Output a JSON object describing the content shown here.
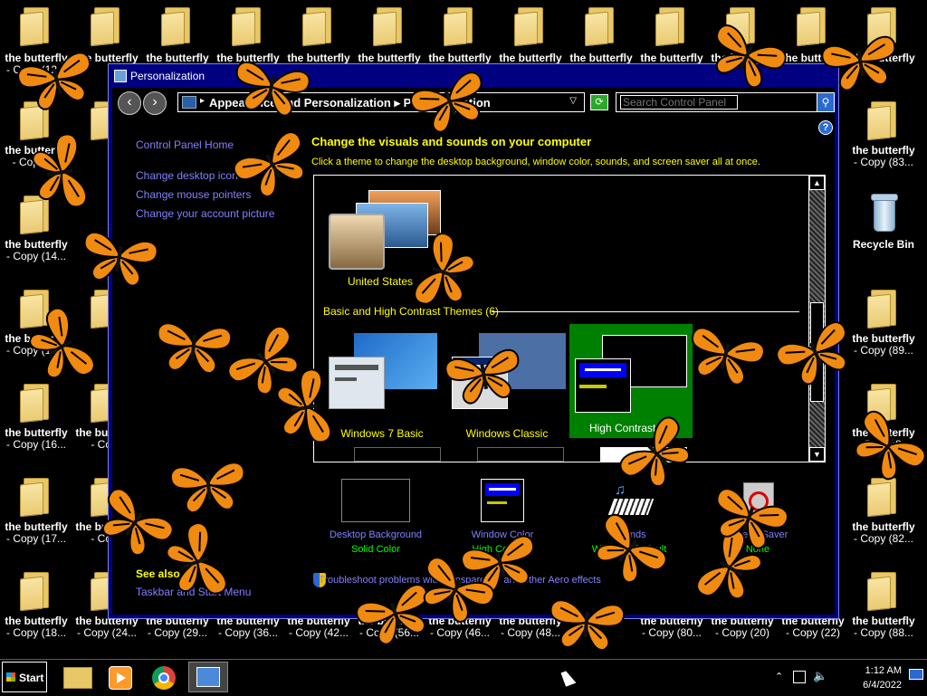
{
  "desktop": {
    "icon_title": "the butterfly",
    "left_col": [
      "- Copy (12...",
      "- Copy (14...",
      "- Copy (15...",
      "- Copy (16...",
      "- Copy (17...",
      "- Copy (18..."
    ],
    "col2": [
      "- Copy (24...",
      "- Copy"
    ],
    "bottom_row": [
      "- Copy (29...",
      "- Copy (36...",
      "- Copy (42...",
      "- Copy (56...",
      "- Copy (46...",
      "- Copy (48...",
      "- Copy (80...",
      "- Copy (20)",
      "- Copy (22)",
      "- Copy (88..."
    ],
    "right_col": [
      "- Copy (83...",
      "- Copy (89...",
      "- Copy (8...",
      "- Copy (82..."
    ],
    "recycle_bin": "Recycle Bin"
  },
  "window": {
    "title": "Personalization",
    "address": {
      "segments": [
        "Appearance and Personalization",
        "Personalization"
      ],
      "separator": "▸"
    },
    "search_placeholder": "Search Control Panel",
    "sidebar": {
      "home": "Control Panel Home",
      "links": [
        "Change desktop icons",
        "Change mouse pointers",
        "Change your account picture"
      ],
      "see_also_heading": "See also",
      "see_also_links": [
        "Taskbar and Start Menu"
      ]
    },
    "heading": "Change the visuals and sounds on your computer",
    "subheading": "Click a theme to change the desktop background, window color, sounds, and screen saver all at once.",
    "themes_top": [
      {
        "label": "United States"
      }
    ],
    "group_heading": "Basic and High Contrast Themes (6)",
    "themes_basic": [
      {
        "label": "Windows 7 Basic"
      },
      {
        "label": "Windows Classic"
      },
      {
        "label": "High Contrast #1"
      }
    ],
    "bottom": {
      "desktop_background": {
        "label": "Desktop Background",
        "sub": "Solid Color"
      },
      "window_color": {
        "label": "Window Color",
        "sub": "High Contrast"
      },
      "sounds": {
        "label": "Sounds",
        "sub": "Windows Default"
      },
      "screen_saver": {
        "label": "Screen Saver",
        "sub": "None"
      }
    },
    "troubleshoot": "Troubleshoot problems with transparency and other Aero effects"
  },
  "taskbar": {
    "start_label": "Start",
    "time": "1:12 AM",
    "date": "6/4/2022"
  },
  "colors": {
    "link": "#8080ff",
    "heading": "#ffff00",
    "subtext": "#00ff00",
    "titlebar": "#000080"
  }
}
